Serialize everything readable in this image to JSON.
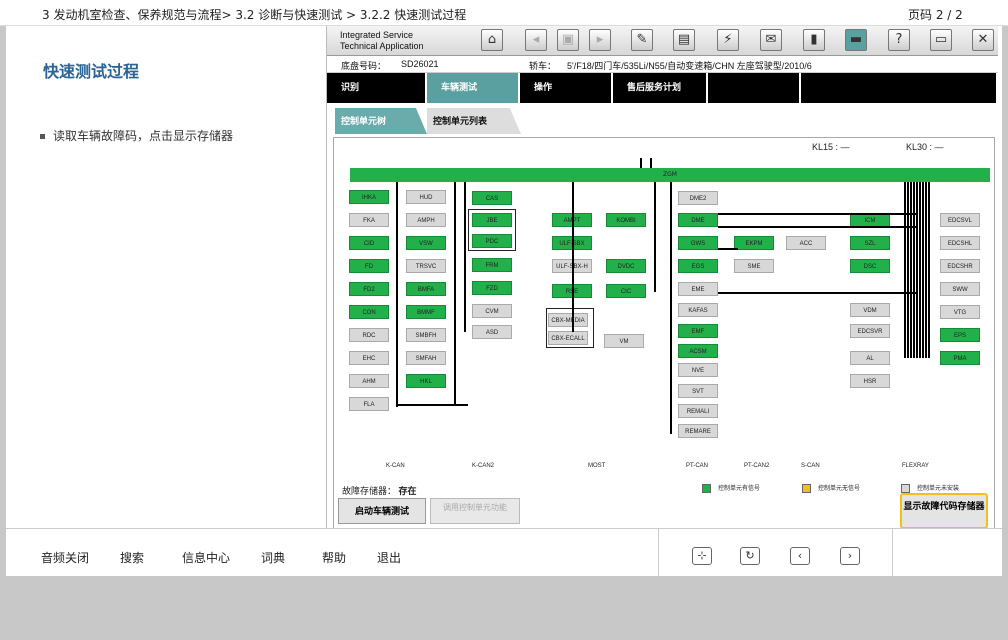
{
  "breadcrumb": "3 发动机室检查、保养规范与流程> 3.2 诊断与快速测试 > 3.2.2 快速测试过程",
  "page_label": "页码  2 / 2",
  "left": {
    "title": "快速测试过程",
    "bullet": "读取车辆故障码，点击显示存储器"
  },
  "app": {
    "title1": "Integrated Service",
    "title2": "Technical Application",
    "vin_label": "底盘号码：",
    "vin": "SD26021",
    "car_label": "轿车：",
    "car": "5'/F18/四门车/535Li/N55/自动变速箱/CHN 左座驾驶型/2010/6",
    "nav": [
      "识别",
      "车辆测试",
      "操作",
      "售后服务计划",
      "",
      ""
    ],
    "subtabs": [
      "控制单元树",
      "控制单元列表"
    ],
    "kl15": "KL15 : —",
    "kl30": "KL30 : —",
    "zgm": "ZGM",
    "ecus": {
      "col1": [
        "IHKA",
        "FKA",
        "CID",
        "FD",
        "FD2",
        "CON",
        "RDC",
        "EHC",
        "AHM",
        "FLA"
      ],
      "col2": [
        "HUD",
        "AMPH",
        "VSW",
        "TRSVC",
        "BMFA",
        "BMMF",
        "SMBFH",
        "SMFAH",
        "HKL"
      ],
      "col3": [
        "CAS",
        "JBE",
        "PDC",
        "FRM",
        "FZD",
        "CVM",
        "ASD"
      ],
      "col4": [
        "AMPT",
        "ULF-SBX",
        "ULF-SBX-H",
        "RSE",
        "CBX-MEDIA",
        "CBX-ECALL"
      ],
      "col5": [
        "KOMBI",
        "DVDC",
        "CIC",
        "VM"
      ],
      "col6": [
        "DME2",
        "DME",
        "GWS",
        "EGS",
        "EME",
        "KAFAS",
        "EMF",
        "ACSM",
        "NVE",
        "SVT",
        "REMALI",
        "REMARE"
      ],
      "col7": [
        "EKPM",
        "SME",
        "ACC"
      ],
      "col8": [
        "ICM",
        "SZL",
        "DSC",
        "VDM",
        "EDCSVR",
        "AL",
        "HSR"
      ],
      "col9": [
        "EDCSVL",
        "EDCSHL",
        "EDCSHR",
        "SWW",
        "VTG",
        "EPS",
        "PMA"
      ]
    },
    "buses": [
      "K-CAN",
      "K-CAN2",
      "MOST",
      "PT-CAN",
      "PT-CAN2",
      "S-CAN",
      "FLEXRAY"
    ],
    "fault_label": "故障存储器：",
    "fault_value": "存在",
    "legend": [
      "控制单元有信号",
      "控制单元无信号",
      "控制单元未安装"
    ],
    "btn_start": "启动车辆测试",
    "btn_call": "调用控制单元功能",
    "btn_show": "显示故障代码存储器"
  },
  "bottom": [
    "音频关闭",
    "搜索",
    "信息中心",
    "词典",
    "帮助",
    "退出"
  ],
  "colors": {
    "ok": "#22b04a",
    "nosig": "#d8d8d8",
    "accent": "#2a6496",
    "tab": "#5aa0a0",
    "highlight": "#f0c020"
  }
}
